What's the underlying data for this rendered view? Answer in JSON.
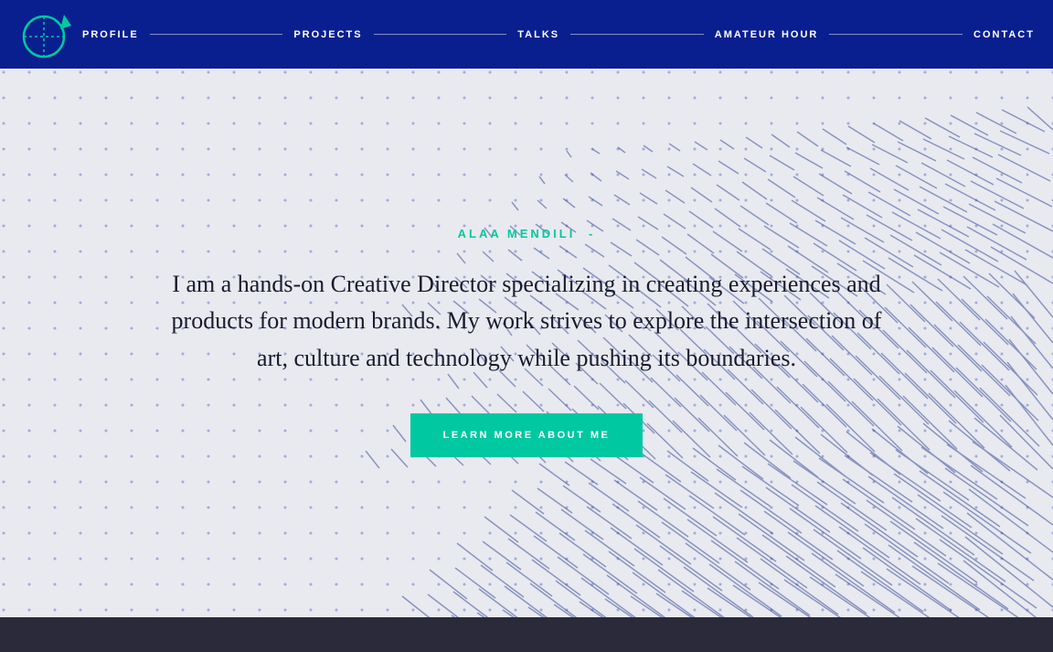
{
  "nav": {
    "links": [
      {
        "label": "PROFILE",
        "id": "nav-profile"
      },
      {
        "label": "PROJECTS",
        "id": "nav-projects"
      },
      {
        "label": "TALKS",
        "id": "nav-talks"
      },
      {
        "label": "AMATEUR HOUR",
        "id": "nav-amateur-hour"
      },
      {
        "label": "CONTACT",
        "id": "nav-contact"
      }
    ]
  },
  "hero": {
    "name": "ALAA MENDILI",
    "dash": "-",
    "body": "I am a hands-on Creative Director specializing in creating experiences and products for modern brands. My work strives to explore the intersection of art, culture and technology while pushing its boundaries.",
    "cta": "LEARN MORE ABOUT ME"
  },
  "colors": {
    "navBg": "#0a1f8f",
    "accent": "#00c8a0",
    "bodyBg": "#e8eaf0",
    "textDark": "#1a1a2e",
    "dotColor": "#2233aa"
  }
}
